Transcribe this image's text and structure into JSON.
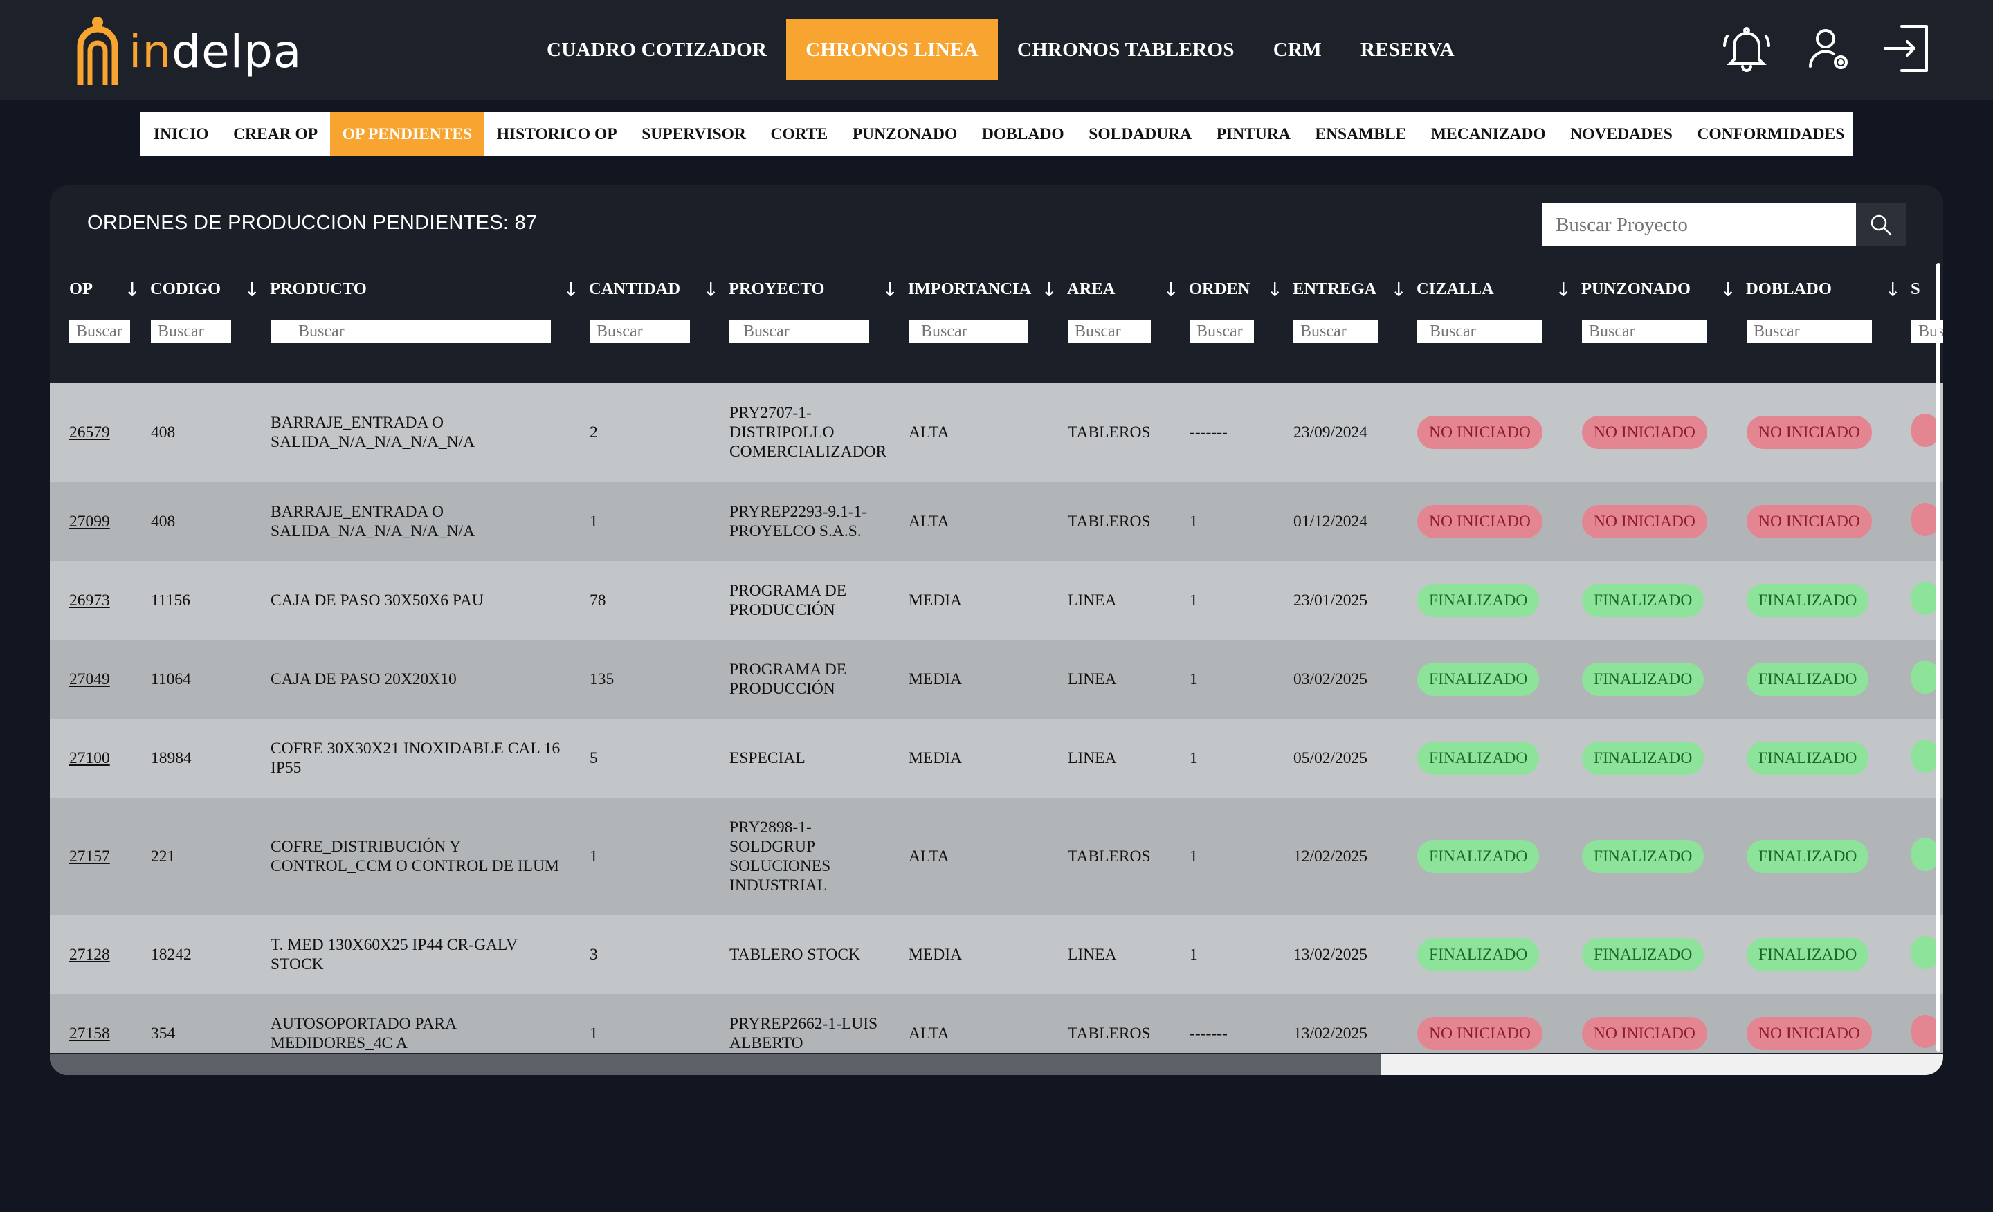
{
  "header": {
    "logo_text": "indelpa",
    "nav": [
      {
        "label": "CUADRO COTIZADOR",
        "active": false
      },
      {
        "label": "CHRONOS LINEA",
        "active": true
      },
      {
        "label": "CHRONOS TABLEROS",
        "active": false
      },
      {
        "label": "CRM",
        "active": false
      },
      {
        "label": "RESERVA",
        "active": false
      }
    ],
    "icons": [
      "bell-icon",
      "user-settings-icon",
      "logout-icon"
    ]
  },
  "subnav": [
    {
      "label": "INICIO",
      "active": false
    },
    {
      "label": "CREAR OP",
      "active": false
    },
    {
      "label": "OP PENDIENTES",
      "active": true
    },
    {
      "label": "HISTORICO OP",
      "active": false
    },
    {
      "label": "SUPERVISOR",
      "active": false
    },
    {
      "label": "CORTE",
      "active": false
    },
    {
      "label": "PUNZONADO",
      "active": false
    },
    {
      "label": "DOBLADO",
      "active": false
    },
    {
      "label": "SOLDADURA",
      "active": false
    },
    {
      "label": "PINTURA",
      "active": false
    },
    {
      "label": "ENSAMBLE",
      "active": false
    },
    {
      "label": "MECANIZADO",
      "active": false
    },
    {
      "label": "NOVEDADES",
      "active": false
    },
    {
      "label": "CONFORMIDADES",
      "active": false
    }
  ],
  "panel": {
    "title": "ORDENES DE PRODUCCION PENDIENTES: 87",
    "search_placeholder": "Buscar Proyecto"
  },
  "table": {
    "filter_placeholder": "Buscar",
    "columns": [
      {
        "label": "OP",
        "arrow": "↓"
      },
      {
        "label": "CODIGO",
        "arrow": "↓"
      },
      {
        "label": "PRODUCTO",
        "arrow": "↓"
      },
      {
        "label": "CANTIDAD",
        "arrow": "↓"
      },
      {
        "label": "PROYECTO",
        "arrow": "↓"
      },
      {
        "label": "IMPORTANCIA",
        "arrow": "↓"
      },
      {
        "label": "AREA",
        "arrow": "↓"
      },
      {
        "label": "ORDEN",
        "arrow": "↓"
      },
      {
        "label": "ENTREGA",
        "arrow": "↓"
      },
      {
        "label": "CIZALLA",
        "arrow": "↓"
      },
      {
        "label": "PUNZONADO",
        "arrow": "↓"
      },
      {
        "label": "DOBLADO",
        "arrow": "↓"
      },
      {
        "label": "S",
        "arrow": ""
      }
    ],
    "rows": [
      {
        "op": "26579",
        "codigo": "408",
        "producto": "BARRAJE_ENTRADA O SALIDA_N/A_N/A_N/A_N/A",
        "cantidad": "2",
        "proyecto": "PRY2707-1-DISTRIPOLLO COMERCIALIZADOR",
        "importancia": "ALTA",
        "area": "TABLEROS",
        "orden": "-------",
        "entrega": "23/09/2024",
        "cizalla": "NO INICIADO",
        "punzonado": "NO INICIADO",
        "doblado": "NO INICIADO",
        "status": "red"
      },
      {
        "op": "27099",
        "codigo": "408",
        "producto": "BARRAJE_ENTRADA O SALIDA_N/A_N/A_N/A_N/A",
        "cantidad": "1",
        "proyecto": "PRYREP2293-9.1-1-PROYELCO S.A.S.",
        "importancia": "ALTA",
        "area": "TABLEROS",
        "orden": "1",
        "entrega": "01/12/2024",
        "cizalla": "NO INICIADO",
        "punzonado": "NO INICIADO",
        "doblado": "NO INICIADO",
        "status": "red"
      },
      {
        "op": "26973",
        "codigo": "11156",
        "producto": "CAJA DE PASO 30X50X6 PAU",
        "cantidad": "78",
        "proyecto": "PROGRAMA DE PRODUCCIÓN",
        "importancia": "MEDIA",
        "area": "LINEA",
        "orden": "1",
        "entrega": "23/01/2025",
        "cizalla": "FINALIZADO",
        "punzonado": "FINALIZADO",
        "doblado": "FINALIZADO",
        "status": "green"
      },
      {
        "op": "27049",
        "codigo": "11064",
        "producto": "CAJA DE PASO 20X20X10",
        "cantidad": "135",
        "proyecto": "PROGRAMA DE PRODUCCIÓN",
        "importancia": "MEDIA",
        "area": "LINEA",
        "orden": "1",
        "entrega": "03/02/2025",
        "cizalla": "FINALIZADO",
        "punzonado": "FINALIZADO",
        "doblado": "FINALIZADO",
        "status": "green"
      },
      {
        "op": "27100",
        "codigo": "18984",
        "producto": "COFRE 30X30X21 INOXIDABLE CAL 16 IP55",
        "cantidad": "5",
        "proyecto": "ESPECIAL",
        "importancia": "MEDIA",
        "area": "LINEA",
        "orden": "1",
        "entrega": "05/02/2025",
        "cizalla": "FINALIZADO",
        "punzonado": "FINALIZADO",
        "doblado": "FINALIZADO",
        "status": "green"
      },
      {
        "op": "27157",
        "codigo": "221",
        "producto": "COFRE_DISTRIBUCIÓN Y CONTROL_CCM O CONTROL DE ILUM",
        "cantidad": "1",
        "proyecto": "PRY2898-1-SOLDGRUP SOLUCIONES INDUSTRIAL",
        "importancia": "ALTA",
        "area": "TABLEROS",
        "orden": "1",
        "entrega": "12/02/2025",
        "cizalla": "FINALIZADO",
        "punzonado": "FINALIZADO",
        "doblado": "FINALIZADO",
        "status": "green"
      },
      {
        "op": "27128",
        "codigo": "18242",
        "producto": "T. MED 130X60X25 IP44 CR-GALV STOCK",
        "cantidad": "3",
        "proyecto": "TABLERO STOCK",
        "importancia": "MEDIA",
        "area": "LINEA",
        "orden": "1",
        "entrega": "13/02/2025",
        "cizalla": "FINALIZADO",
        "punzonado": "FINALIZADO",
        "doblado": "FINALIZADO",
        "status": "green"
      },
      {
        "op": "27158",
        "codigo": "354",
        "producto": "AUTOSOPORTADO PARA MEDIDORES_4C A",
        "cantidad": "1",
        "proyecto": "PRYREP2662-1-LUIS ALBERTO",
        "importancia": "ALTA",
        "area": "TABLEROS",
        "orden": "-------",
        "entrega": "13/02/2025",
        "cizalla": "NO INICIADO",
        "punzonado": "NO INICIADO",
        "doblado": "NO INICIADO",
        "status": "red"
      }
    ]
  },
  "colors": {
    "accent": "#f7a530",
    "background": "#121620",
    "panel": "#1b1f27",
    "badge_red": "#e38692",
    "badge_green": "#8ee39a"
  }
}
